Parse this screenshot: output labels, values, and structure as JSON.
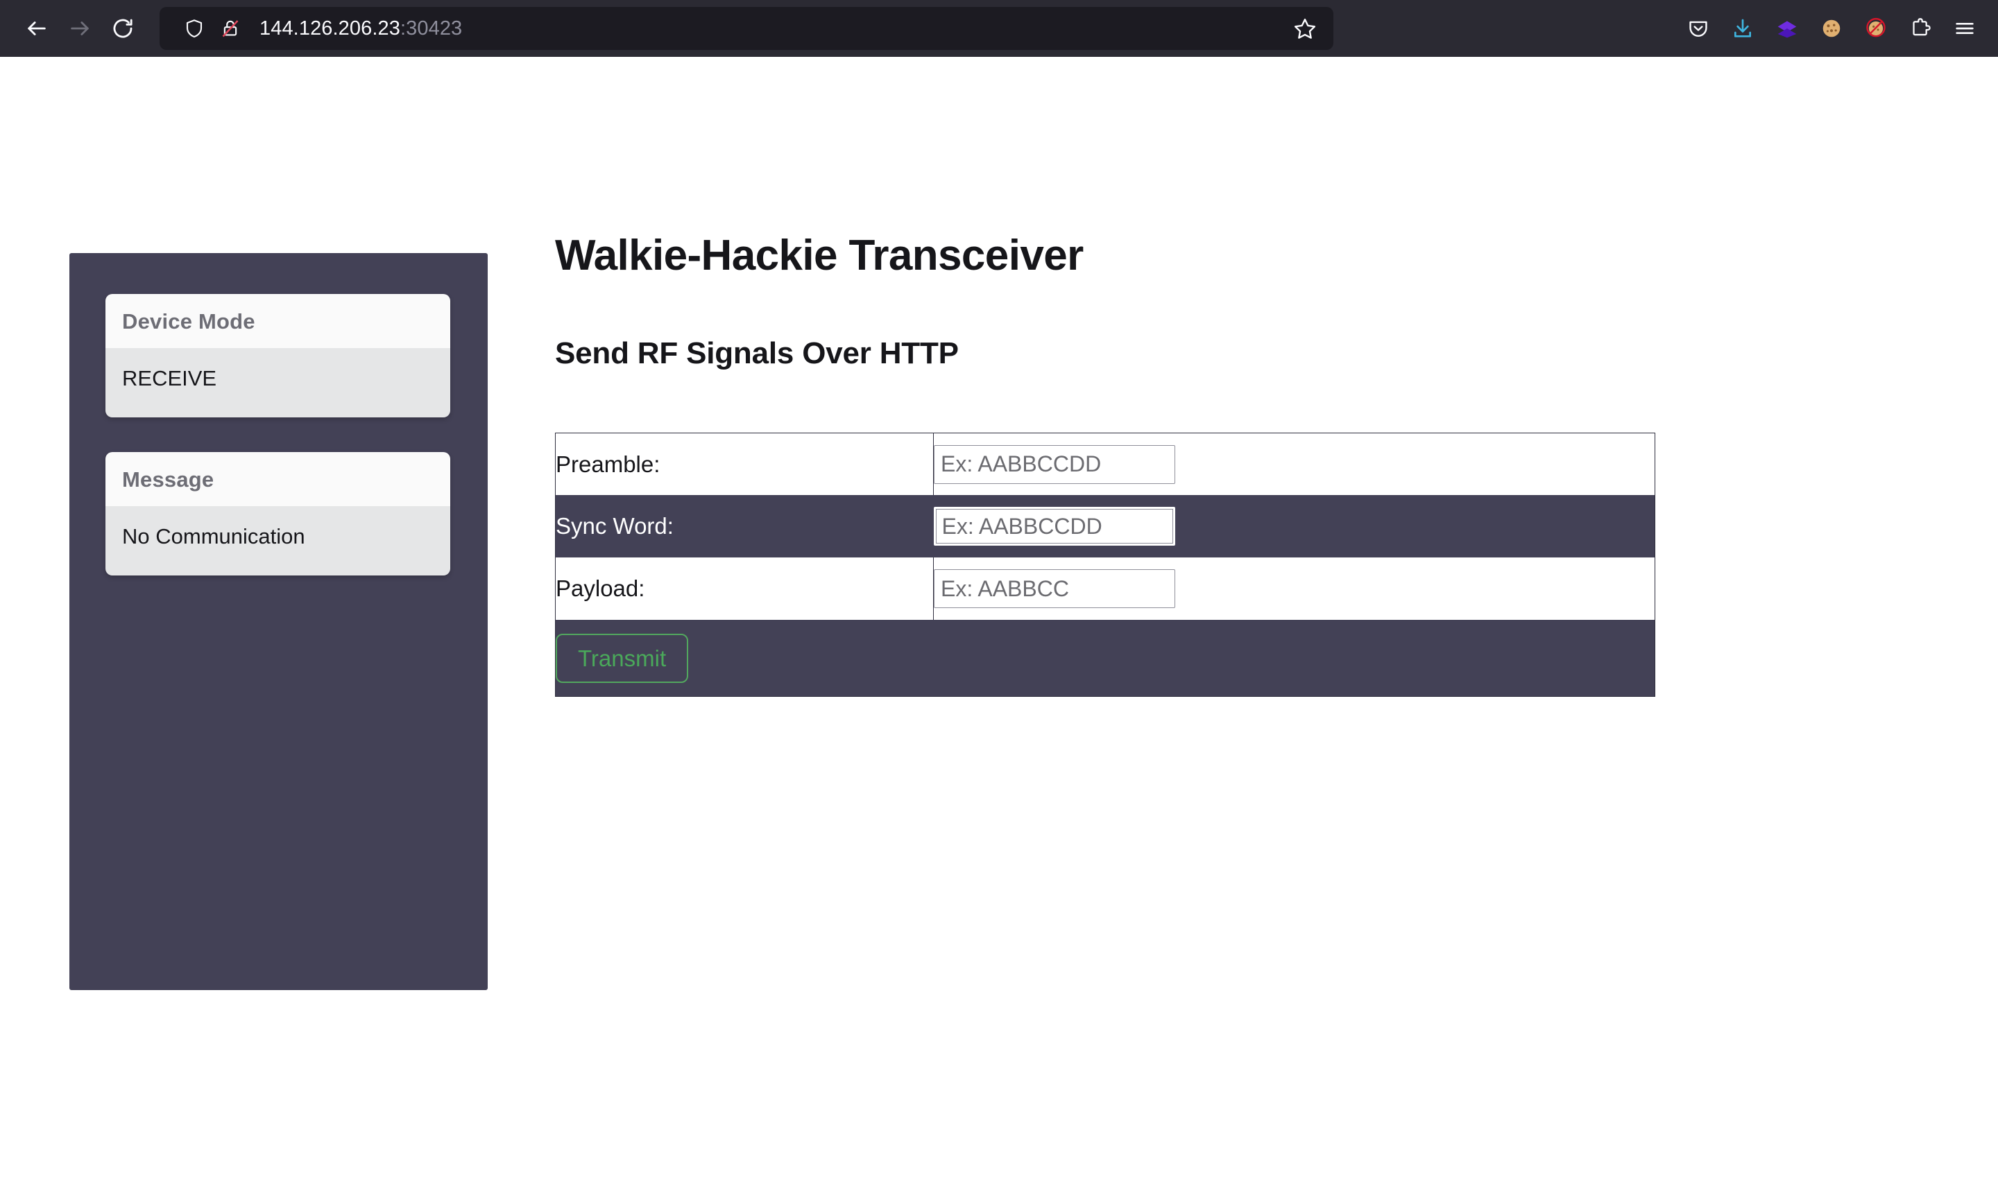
{
  "browser": {
    "back_icon": "back-arrow-icon",
    "forward_icon": "forward-arrow-icon",
    "reload_icon": "reload-icon",
    "shield_icon": "shield-icon",
    "lock_icon": "lock-crossed-out-icon",
    "url_host": "144.126.206.23",
    "url_port": ":30423",
    "star_icon": "star-bookmark-icon",
    "toolbar_icons": [
      {
        "name": "pocket-icon",
        "glyph": "⌄"
      },
      {
        "name": "downloads-icon",
        "glyph": "↓"
      },
      {
        "name": "layers-icon",
        "glyph": "◆"
      },
      {
        "name": "cookie-icon",
        "glyph": "🍪"
      },
      {
        "name": "cookie-blocked-icon",
        "glyph": "🍪"
      },
      {
        "name": "extensions-puzzle-icon",
        "glyph": "🧩"
      },
      {
        "name": "app-menu-icon",
        "glyph": "☰"
      }
    ],
    "colors": {
      "chrome_bg": "#2b2a33",
      "urlbar_bg": "#1c1b22",
      "url_text": "#fbfbfe",
      "url_port_text": "#8f8f9d"
    }
  },
  "sidebar": {
    "cards": [
      {
        "header": "Device Mode",
        "value": "RECEIVE"
      },
      {
        "header": "Message",
        "value": "No Communication"
      }
    ],
    "colors": {
      "panel_bg": "#434156",
      "card_header_bg": "#fafafa",
      "card_body_bg": "#e5e6e7",
      "card_header_text": "#6d6d75"
    }
  },
  "main": {
    "title": "Walkie-Hackie Transceiver",
    "subtitle": "Send RF Signals Over HTTP",
    "form": {
      "rows": [
        {
          "label": "Preamble:",
          "placeholder": "Ex: AABBCCDD",
          "value": "",
          "focused": false
        },
        {
          "label": "Sync Word:",
          "placeholder": "Ex: AABBCCDD",
          "value": "",
          "focused": true
        },
        {
          "label": "Payload:",
          "placeholder": "Ex: AABBCC",
          "value": "",
          "focused": false
        }
      ],
      "transmit_label": "Transmit",
      "colors": {
        "row_light_bg": "#ffffff",
        "row_dark_bg": "#434156",
        "table_border": "#2f2e3e",
        "transmit_green": "#52a75e",
        "placeholder_gray": "#6b6b70"
      }
    }
  }
}
